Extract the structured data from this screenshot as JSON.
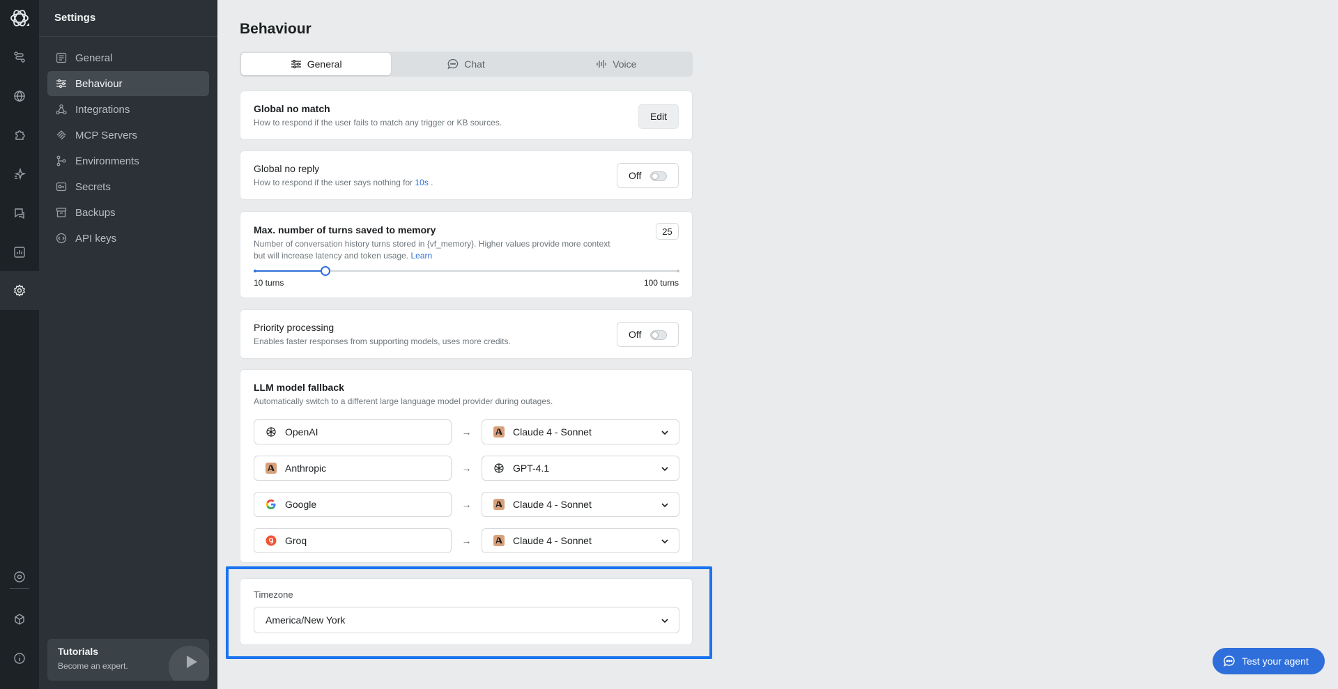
{
  "sidebar": {
    "title": "Settings",
    "items": [
      {
        "label": "General",
        "icon": "list-icon"
      },
      {
        "label": "Behaviour",
        "icon": "sliders-icon",
        "active": true
      },
      {
        "label": "Integrations",
        "icon": "integrations-icon"
      },
      {
        "label": "MCP Servers",
        "icon": "mcp-icon"
      },
      {
        "label": "Environments",
        "icon": "environments-icon"
      },
      {
        "label": "Secrets",
        "icon": "key-icon"
      },
      {
        "label": "Backups",
        "icon": "archive-icon"
      },
      {
        "label": "API keys",
        "icon": "api-icon"
      }
    ],
    "tutorials": {
      "title": "Tutorials",
      "subtitle": "Become an expert."
    }
  },
  "rail": {
    "icons": [
      "logo-icon",
      "workflow-icon",
      "globe-icon",
      "puzzle-icon",
      "sparkle-icon",
      "chat-icon",
      "analytics-icon",
      "settings-icon",
      "target-icon",
      "cube-icon",
      "info-icon"
    ]
  },
  "page": {
    "title": "Behaviour",
    "tabs": [
      {
        "label": "General",
        "active": true
      },
      {
        "label": "Chat"
      },
      {
        "label": "Voice"
      }
    ]
  },
  "no_match": {
    "title": "Global no match",
    "description": "How to respond if the user fails to match any trigger or KB sources.",
    "edit_label": "Edit"
  },
  "no_reply": {
    "title": "Global no reply",
    "description_prefix": "How to respond if the user says nothing for",
    "timeout": "10s",
    "description_suffix": ".",
    "toggle_label": "Off",
    "enabled": false
  },
  "memory": {
    "title": "Max. number of turns saved to memory",
    "value": "25",
    "description_line1": "Number of conversation history turns stored in {vf_memory}. Higher values provide more context",
    "description_line2": "but will increase latency and token usage.",
    "learn_label": "Learn",
    "min_label": "10 turns",
    "max_label": "100 turns",
    "min": 10,
    "max": 100,
    "current": 25
  },
  "priority": {
    "title": "Priority processing",
    "description": "Enables faster responses from supporting models, uses more credits.",
    "toggle_label": "Off",
    "enabled": false
  },
  "fallback": {
    "title": "LLM model fallback",
    "description": "Automatically switch to a different large language model provider during outages.",
    "arrow": "→",
    "rows": [
      {
        "source": "OpenAI",
        "source_icon": "openai-icon",
        "target": "Claude 4 - Sonnet",
        "target_icon": "anthropic-icon"
      },
      {
        "source": "Anthropic",
        "source_icon": "anthropic-icon",
        "target": "GPT-4.1",
        "target_icon": "openai-icon"
      },
      {
        "source": "Google",
        "source_icon": "google-icon",
        "target": "Claude 4 - Sonnet",
        "target_icon": "anthropic-icon"
      },
      {
        "source": "Groq",
        "source_icon": "groq-icon",
        "target": "Claude 4 - Sonnet",
        "target_icon": "anthropic-icon"
      }
    ]
  },
  "timezone": {
    "label": "Timezone",
    "value": "America/New York"
  },
  "test_agent": {
    "label": "Test your agent"
  },
  "colors": {
    "accent": "#2f6fdb",
    "highlight": "#1a73f0",
    "rail_bg": "#1d2226",
    "sidebar_bg": "#2b3136",
    "page_bg": "#e9ebec"
  }
}
